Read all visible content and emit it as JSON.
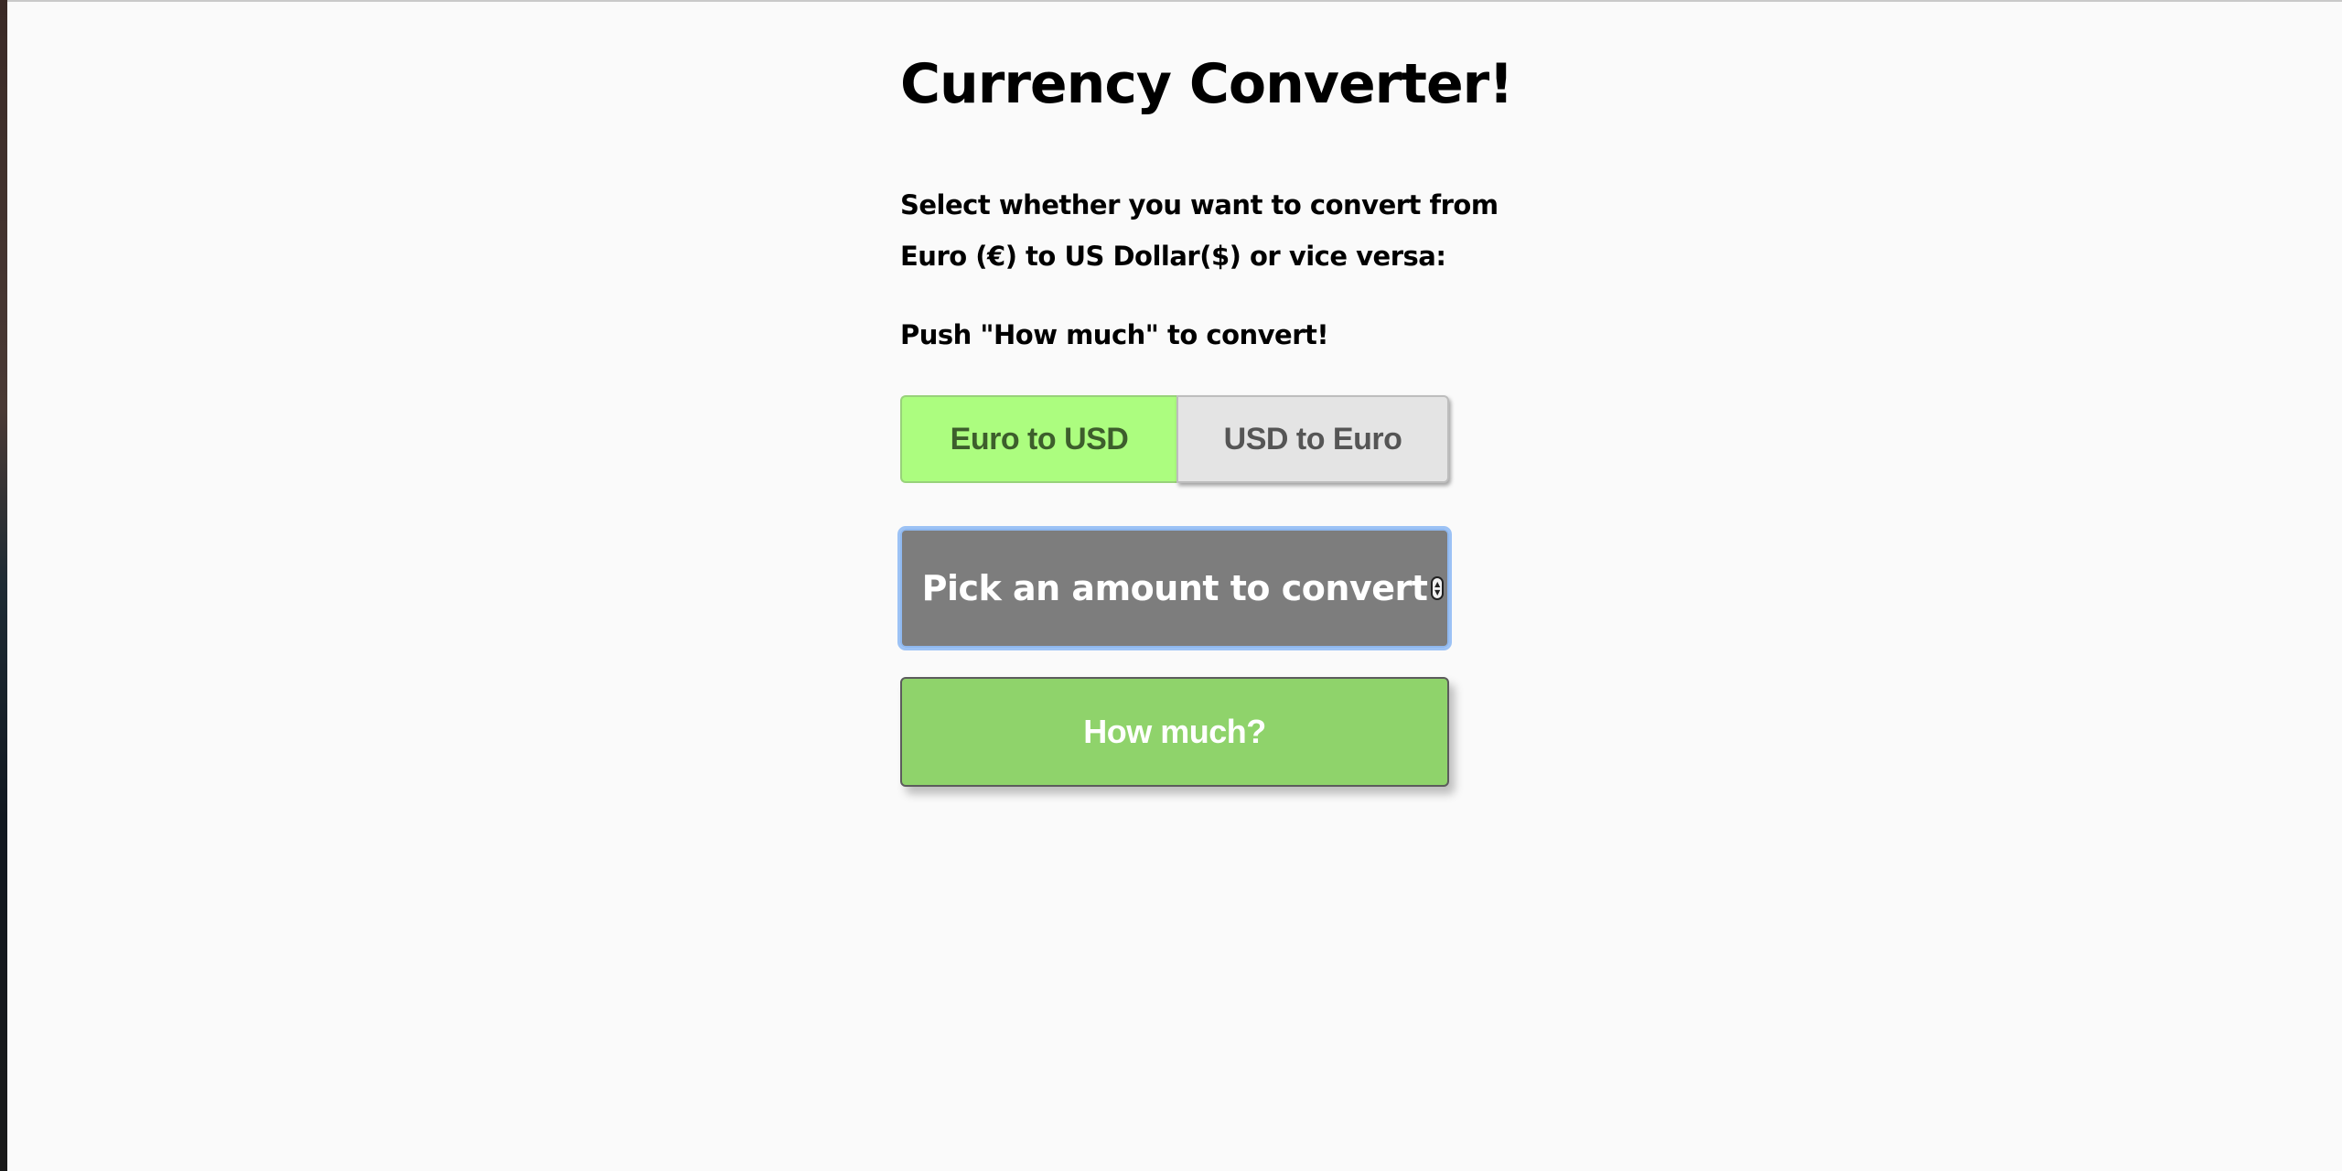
{
  "page": {
    "title": "Currency Converter!",
    "instructions_line1": "Select whether you want to convert from",
    "instructions_line2": "Euro (€) to US Dollar($) or vice versa:",
    "push_text": "Push \"How much\" to convert!"
  },
  "toggle": {
    "options": [
      "Euro to USD",
      "USD to Euro"
    ],
    "selected": "Euro to USD"
  },
  "amount_input": {
    "placeholder": "Pick an amount to convert",
    "value": ""
  },
  "actions": {
    "submit_label": "How much?"
  },
  "colors": {
    "background": "#fafafa",
    "selected_toggle": "#acfd7f",
    "unselected_toggle": "#e4e4e4",
    "input_background": "#7d7d7d",
    "input_focus_ring": "#9cc2f5",
    "submit_button": "#8fd36b"
  },
  "icons": {
    "spinner": "number-spinner-icon"
  }
}
